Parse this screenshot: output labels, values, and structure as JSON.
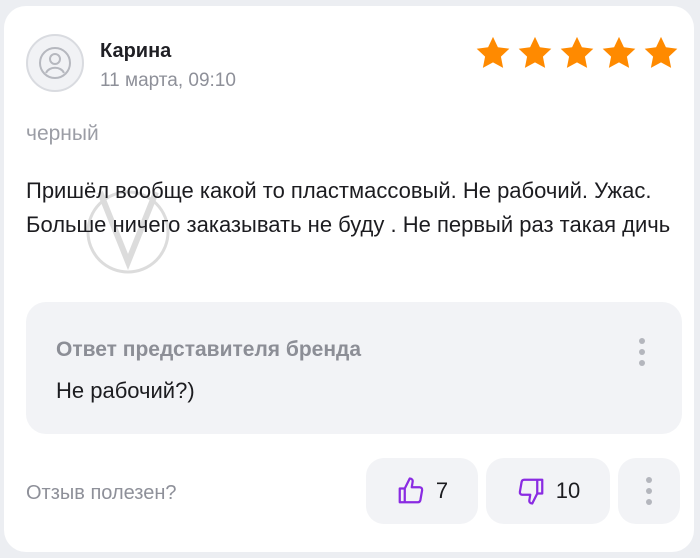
{
  "review": {
    "author": "Карина",
    "date": "11 марта, 09:10",
    "rating": 5,
    "rating_max": 5,
    "variant": "черный",
    "text": "Пришёл вообще какой то пластмассовый. Не рабочий. Ужас. Больше ничего заказывать не буду . Не первый раз такая дичь"
  },
  "reply": {
    "title": "Ответ представителя бренда",
    "text": "Не рабочий?)"
  },
  "footer": {
    "helpful_label": "Отзыв полезен?",
    "likes": "7",
    "dislikes": "10"
  },
  "colors": {
    "star": "#ff8a00",
    "accent": "#8a2be2"
  },
  "icons": {
    "avatar": "user-icon",
    "star": "star-icon",
    "like": "thumbs-up-icon",
    "dislike": "thumbs-down-icon",
    "more": "more-vertical-icon"
  }
}
